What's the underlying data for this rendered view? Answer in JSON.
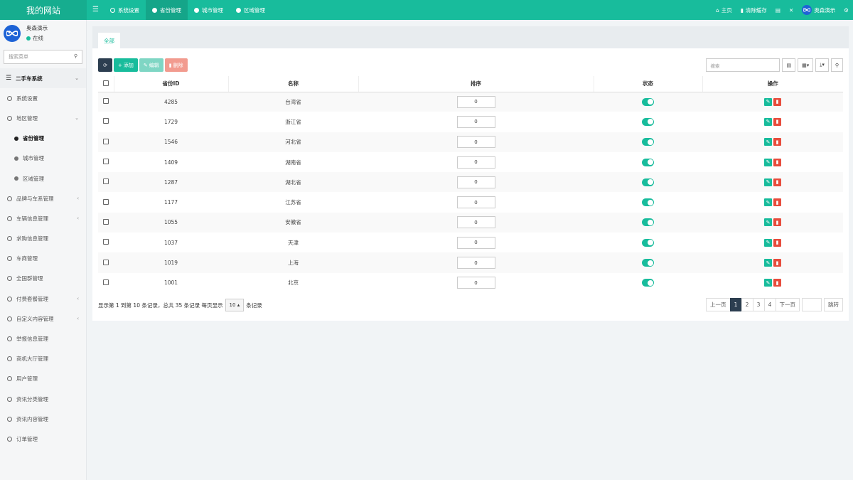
{
  "site_title": "我的网站",
  "top_tabs": [
    {
      "label": "系统设置",
      "style": "outline",
      "active": false
    },
    {
      "label": "省份管理",
      "style": "filled",
      "active": true
    },
    {
      "label": "城市管理",
      "style": "filled",
      "active": false
    },
    {
      "label": "区域管理",
      "style": "filled",
      "active": false
    }
  ],
  "top_right": {
    "home": "主页",
    "clear_cache": "清除缓存",
    "user": "奥森演示"
  },
  "user_panel": {
    "name": "奥森演示",
    "status": "在线"
  },
  "menu_search_placeholder": "搜索菜单",
  "menu": {
    "header": "二手车系统",
    "items": [
      {
        "label": "系统设置"
      },
      {
        "label": "地区管理"
      },
      {
        "label": "省份管理"
      },
      {
        "label": "城市管理"
      },
      {
        "label": "区域管理"
      },
      {
        "label": "品牌与车系管理"
      },
      {
        "label": "车辆信息管理"
      },
      {
        "label": "求购信息管理"
      },
      {
        "label": "车商管理"
      },
      {
        "label": "全国群管理"
      },
      {
        "label": "付费套餐管理"
      },
      {
        "label": "自定义内容管理"
      },
      {
        "label": "举报信息管理"
      },
      {
        "label": "商机大厅管理"
      },
      {
        "label": "用户管理"
      },
      {
        "label": "资讯分类管理"
      },
      {
        "label": "资讯内容管理"
      },
      {
        "label": "订单管理"
      }
    ]
  },
  "panel_tab": "全部",
  "toolbar": {
    "add": "添加",
    "edit": "编辑",
    "delete": "删除"
  },
  "table_search_placeholder": "搜索",
  "columns": [
    "省份ID",
    "名称",
    "排序",
    "状态",
    "操作"
  ],
  "rows": [
    {
      "id": "4285",
      "name": "台湾省",
      "order": "0"
    },
    {
      "id": "1729",
      "name": "浙江省",
      "order": "0"
    },
    {
      "id": "1546",
      "name": "河北省",
      "order": "0"
    },
    {
      "id": "1409",
      "name": "湖南省",
      "order": "0"
    },
    {
      "id": "1287",
      "name": "湖北省",
      "order": "0"
    },
    {
      "id": "1177",
      "name": "江苏省",
      "order": "0"
    },
    {
      "id": "1055",
      "name": "安徽省",
      "order": "0"
    },
    {
      "id": "1037",
      "name": "天津",
      "order": "0"
    },
    {
      "id": "1019",
      "name": "上海",
      "order": "0"
    },
    {
      "id": "1001",
      "name": "北京",
      "order": "0"
    }
  ],
  "footer": {
    "info": "显示第 1 到第 10 条记录，总共 35 条记录 每页显示",
    "page_size": "10",
    "suffix": "条记录"
  },
  "pager": {
    "prev": "上一页",
    "pages": [
      "1",
      "2",
      "3",
      "4"
    ],
    "next": "下一页",
    "jump": "跳转"
  }
}
